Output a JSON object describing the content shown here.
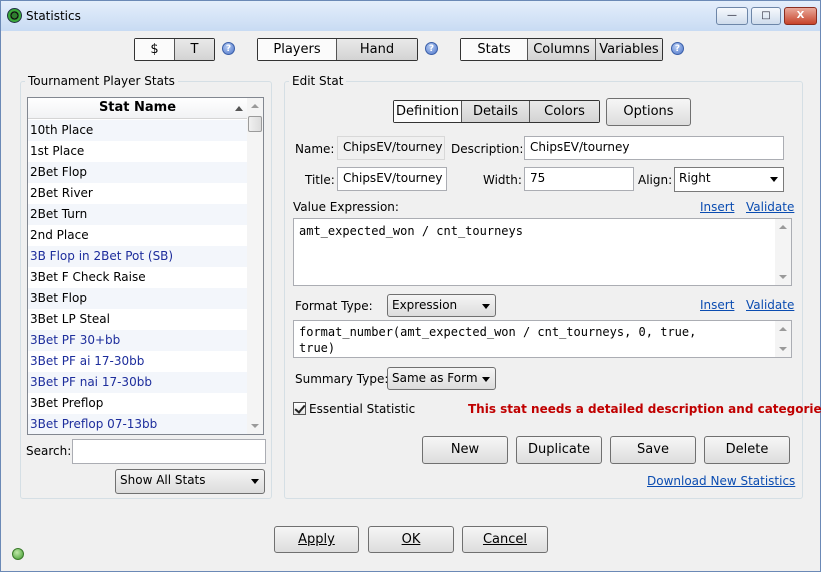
{
  "window": {
    "title": "Statistics",
    "minimize_label": "—",
    "maximize_label": "□",
    "close_label": "X"
  },
  "toolbar": {
    "group1": [
      "$",
      "T"
    ],
    "group2": [
      "Players",
      "Hand"
    ],
    "group3": [
      "Stats",
      "Columns",
      "Variables"
    ],
    "help_label": "?"
  },
  "left_panel": {
    "title": "Tournament Player Stats",
    "column_header": "Stat Name",
    "rows": [
      {
        "name": "10th Place",
        "blue": false
      },
      {
        "name": "1st Place",
        "blue": false
      },
      {
        "name": "2Bet Flop",
        "blue": false
      },
      {
        "name": "2Bet River",
        "blue": false
      },
      {
        "name": "2Bet Turn",
        "blue": false
      },
      {
        "name": "2nd Place",
        "blue": false
      },
      {
        "name": "3B Flop in 2Bet Pot (SB)",
        "blue": true
      },
      {
        "name": "3Bet F Check Raise",
        "blue": false
      },
      {
        "name": "3Bet Flop",
        "blue": false
      },
      {
        "name": "3Bet LP Steal",
        "blue": false
      },
      {
        "name": "3Bet PF 30+bb",
        "blue": true
      },
      {
        "name": "3Bet PF ai 17-30bb",
        "blue": true
      },
      {
        "name": "3Bet PF nai 17-30bb",
        "blue": true
      },
      {
        "name": "3Bet Preflop",
        "blue": false
      },
      {
        "name": "3Bet Preflop 07-13bb",
        "blue": true
      }
    ],
    "search_label": "Search:",
    "search_value": "",
    "filter_value": "Show All Stats"
  },
  "edit_stat": {
    "title": "Edit Stat",
    "tabs": [
      "Definition",
      "Details",
      "Colors"
    ],
    "options_label": "Options",
    "name_label": "Name:",
    "name_value": "ChipsEV/tourney",
    "description_label": "Description:",
    "description_value": "ChipsEV/tourney",
    "title_label": "Title:",
    "title_value": "ChipsEV/tourney",
    "width_label": "Width:",
    "width_value": "75",
    "align_label": "Align:",
    "align_value": "Right",
    "value_expression_label": "Value Expression:",
    "insert_label": "Insert",
    "validate_label": "Validate",
    "value_expression": "amt_expected_won / cnt_tourneys",
    "format_type_label": "Format Type:",
    "format_type_value": "Expression",
    "format_line1": "format_number(amt_expected_won / cnt_tourneys, 0, true,",
    "format_line2": "true)",
    "summary_type_label": "Summary Type:",
    "summary_type_value": "Same as Form",
    "essential_label": "Essential Statistic",
    "warning": "This stat needs a detailed description and categories",
    "new_label": "New",
    "duplicate_label": "Duplicate",
    "save_label": "Save",
    "delete_label": "Delete",
    "download_label": "Download New Statistics"
  },
  "footer": {
    "apply_label": "Apply",
    "ok_label": "OK",
    "cancel_label": "Cancel"
  }
}
